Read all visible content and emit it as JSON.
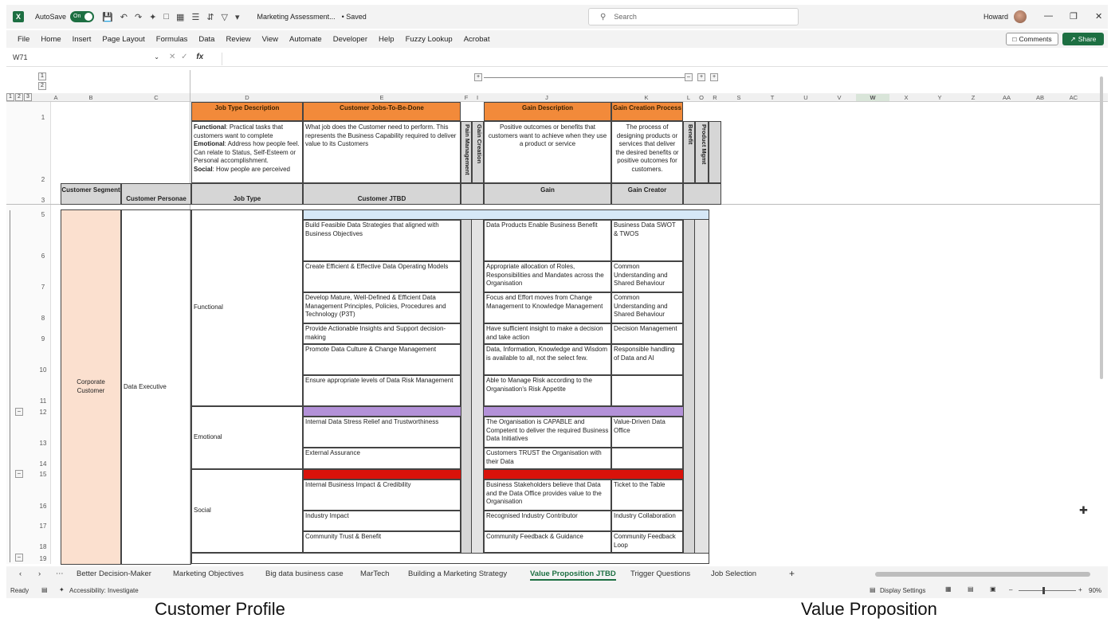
{
  "app": {
    "autosave_label": "AutoSave",
    "autosave_state": "On",
    "document_title": "Marketing Assessment...",
    "saved_status": "• Saved",
    "search_placeholder": "Search",
    "user_name": "Howard",
    "brand_color": "#1d6f42"
  },
  "menu": [
    "File",
    "Home",
    "Insert",
    "Page Layout",
    "Formulas",
    "Data",
    "Review",
    "View",
    "Automate",
    "Developer",
    "Help",
    "Fuzzy Lookup",
    "Acrobat"
  ],
  "actions": {
    "comments": "Comments",
    "share": "Share"
  },
  "formula": {
    "cell_ref": "W71",
    "fx": "fx"
  },
  "outline_levels": [
    "1",
    "2",
    "3"
  ],
  "outline_rows": [
    "1",
    "2"
  ],
  "columns": [
    "A",
    "B",
    "C",
    "D",
    "E",
    "F",
    "I",
    "J",
    "K",
    "L",
    "O",
    "R",
    "S",
    "T",
    "U",
    "V",
    "W",
    "X",
    "Y",
    "Z",
    "AA",
    "AB",
    "AC"
  ],
  "headers": {
    "job_type_desc": "Job Type Description",
    "customer_jobs": "Customer Jobs-To-Be-Done",
    "pain_mgmt": "Pain Management",
    "gain_creation": "Gain Creation",
    "gain_desc": "Gain Description",
    "gain_creation_process": "Gain Creation Process",
    "benefit": "Benefit",
    "product_mgmt": "Product Mgmt"
  },
  "descriptions": {
    "functional_label": "Functional",
    "functional_text": ": Practical tasks that customers want to complete",
    "emotional_label": "Emotional",
    "emotional_text": ": Address how people feel. Can relate to Status, Self-Esteem or Personal accomplishment.",
    "social_label": "Social",
    "social_text": ": How people are perceived",
    "jobs_text": "What job does the Customer need to perform. This represents the Business Capability required to deliver value to its Customers",
    "gain_text": "Positive outcomes or benefits that customers want to achieve when they use a product or service",
    "process_text": "The process of designing products or services that deliver the desired benefits or positive outcomes for customers."
  },
  "subheaders": {
    "segment": "Customer Segment",
    "persona": "Customer Personae",
    "job_type": "Job Type",
    "jtbd": "Customer JTBD",
    "gain": "Gain",
    "gain_creator": "Gain Creator"
  },
  "row_numbers": [
    "1",
    "2",
    "3",
    "5",
    "6",
    "7",
    "8",
    "9",
    "10",
    "11",
    "12",
    "13",
    "14",
    "15",
    "16",
    "17",
    "18",
    "19"
  ],
  "segment": "Corporate Customer",
  "persona": "Data Executive",
  "job_types": [
    "Functional",
    "Emotional",
    "Social"
  ],
  "rows": [
    {
      "jtbd": "Build Feasible Data Strategies that aligned with Business Objectives",
      "gain": "Data Products Enable Business Benefit",
      "creator": "Business Data SWOT & TWOS"
    },
    {
      "jtbd": "Create Efficient & Effective Data Operating Models",
      "gain": "Appropriate allocation of Roles, Responsibilities and Mandates across the Organisation",
      "creator": "Common Understanding and Shared Behaviour"
    },
    {
      "jtbd": "Develop Mature, Well-Defined & Efficient Data Management Principles, Policies, Procedures and Technology (P3T)",
      "gain": "Focus and Effort moves from Change Management to Knowledge Management",
      "creator": "Common Understanding and Shared Behaviour"
    },
    {
      "jtbd": "Provide Actionable Insights and Support decision-making",
      "gain": "Have sufficient insight to make a decision and take action",
      "creator": "Decision Management"
    },
    {
      "jtbd": "Promote Data Culture & Change Management",
      "gain": "Data, Information, Knowledge and Wisdom is available to all, not the select few.",
      "creator": "Responsible handling of Data and AI"
    },
    {
      "jtbd": "Ensure appropriate levels of Data Risk Management",
      "gain": "Able to Manage Risk according to the Organisation's Risk Appetite",
      "creator": ""
    },
    {
      "jtbd": "Internal Data Stress Relief and Trustworthiness",
      "gain": "The Organisation is CAPABLE and Competent to deliver the required Business Data Initiatives",
      "creator": "Value-Driven Data Office"
    },
    {
      "jtbd": "External Assurance",
      "gain": "Customers TRUST the Organisation with their Data",
      "creator": ""
    },
    {
      "jtbd": "Internal Business Impact & Credibility",
      "gain": "Business Stakeholders believe that Data and the Data Office provides value to the Organisation",
      "creator": "Ticket to the Table"
    },
    {
      "jtbd": "Industry Impact",
      "gain": "Recognised Industry Contributor",
      "creator": "Industry Collaboration"
    },
    {
      "jtbd": "Community Trust & Benefit",
      "gain": "Community Feedback & Guidance",
      "creator": "Community Feedback Loop"
    }
  ],
  "band_colors": {
    "functional": "#d6e8f7",
    "emotional": "#b391d8",
    "social": "#d9120a",
    "header_orange": "#f28a3a",
    "segment_peach": "#fbe0cf"
  },
  "tabs": [
    "Better Decision-Maker",
    "Marketing Objectives",
    "Big data business case",
    "MarTech",
    "Building a Marketing Strategy",
    "Value Proposition JTBD",
    "Trigger Questions",
    "Job Selection"
  ],
  "active_tab": "Value Proposition JTBD",
  "status": {
    "ready": "Ready",
    "accessibility": "Accessibility: Investigate",
    "display_settings": "Display Settings",
    "zoom": "90%"
  },
  "captions": {
    "left": "Customer Profile",
    "right": "Value Proposition"
  }
}
